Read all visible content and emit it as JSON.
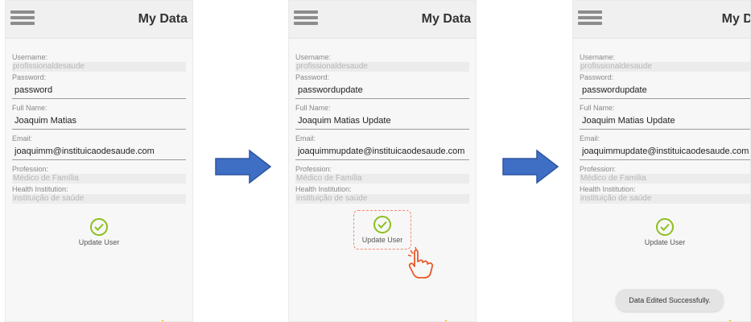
{
  "header": {
    "title": "My Data"
  },
  "labels": {
    "username": "Username:",
    "password": "Password:",
    "full_name": "Full Name:",
    "email": "Email:",
    "profession": "Profession:",
    "health_institution": "Health Institution:"
  },
  "button": {
    "update_label": "Update User"
  },
  "screens": [
    {
      "username": "profissionaldesaude",
      "password": "password",
      "full_name": "Joaquim Matias",
      "email": "joaquimm@instituicaodesaude.com",
      "profession": "Médico de Família",
      "health_institution": "instituição de saúde"
    },
    {
      "username": "profissionaldesaude",
      "password": "passwordupdate",
      "full_name": "Joaquim Matias Update",
      "email": "joaquimmupdate@instituicaodesaude.com",
      "profession": "Médico de Família",
      "health_institution": "instituição de saúde"
    },
    {
      "username": "profissionaldesaude",
      "password": "passwordupdate",
      "full_name": "Joaquim Matias Update",
      "email": "joaquimmupdate@instituicaodesaude.com",
      "profession": "Médico de Família",
      "health_institution": "instituição de saúde"
    }
  ],
  "toast": {
    "message": "Data Edited Successfully."
  },
  "colors": {
    "accent_check": "#8cbf1e",
    "arrow": "#3f6fc4",
    "highlight": "#f08a70",
    "corner_badge": "#f2c200"
  },
  "icons": [
    "menu-icon",
    "check-circle-icon",
    "right-arrow-icon",
    "tap-hand-icon"
  ]
}
